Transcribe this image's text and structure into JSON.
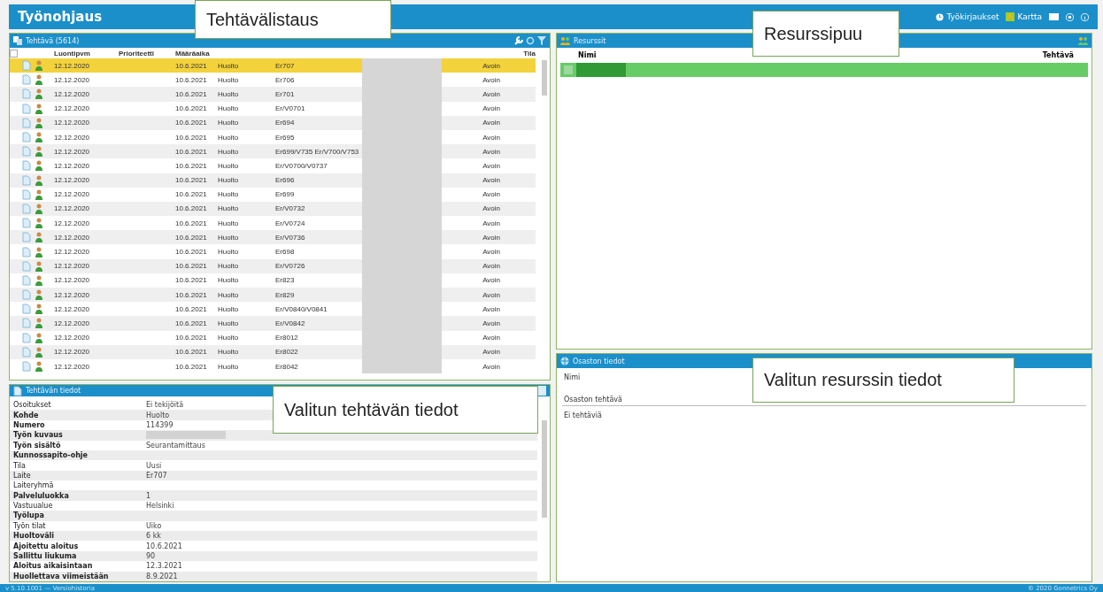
{
  "app": {
    "title": "Työnohjaus",
    "nav": [
      {
        "label": "Työkirjaukset",
        "kind": "clock"
      },
      {
        "label": "Kartta",
        "kind": "map"
      }
    ]
  },
  "task_list": {
    "title": "Tehtävä (5614)",
    "select_all_checked": false,
    "header": {
      "created": "Luontipvm",
      "priority": "Prioriteetti",
      "due": "Määräaika",
      "status": "Tila"
    },
    "rows": [
      {
        "created": "12.12.2020",
        "due": "10.6.2021",
        "type": "Huolto",
        "device": "Er707",
        "status": "Avoin",
        "selected": true
      },
      {
        "created": "12.12.2020",
        "due": "10.6.2021",
        "type": "Huolto",
        "device": "Er706",
        "status": "Avoin",
        "selected": false
      },
      {
        "created": "12.12.2020",
        "due": "10.6.2021",
        "type": "Huolto",
        "device": "Er701",
        "status": "Avoin",
        "selected": false
      },
      {
        "created": "12.12.2020",
        "due": "10.6.2021",
        "type": "Huolto",
        "device": "Er/V0701",
        "status": "Avoin",
        "selected": false
      },
      {
        "created": "12.12.2020",
        "due": "10.6.2021",
        "type": "Huolto",
        "device": "Er694",
        "status": "Avoin",
        "selected": false
      },
      {
        "created": "12.12.2020",
        "due": "10.6.2021",
        "type": "Huolto",
        "device": "Er695",
        "status": "Avoin",
        "selected": false
      },
      {
        "created": "12.12.2020",
        "due": "10.6.2021",
        "type": "Huolto",
        "device": "Er699/V735 Er/V700/V753",
        "status": "Avoin",
        "selected": false
      },
      {
        "created": "12.12.2020",
        "due": "10.6.2021",
        "type": "Huolto",
        "device": "Er/V0700/V0737",
        "status": "Avoin",
        "selected": false
      },
      {
        "created": "12.12.2020",
        "due": "10.6.2021",
        "type": "Huolto",
        "device": "Er696",
        "status": "Avoin",
        "selected": false
      },
      {
        "created": "12.12.2020",
        "due": "10.6.2021",
        "type": "Huolto",
        "device": "Er699",
        "status": "Avoin",
        "selected": false
      },
      {
        "created": "12.12.2020",
        "due": "10.6.2021",
        "type": "Huolto",
        "device": "Er/V0732",
        "status": "Avoin",
        "selected": false
      },
      {
        "created": "12.12.2020",
        "due": "10.6.2021",
        "type": "Huolto",
        "device": "Er/V0724",
        "status": "Avoin",
        "selected": false
      },
      {
        "created": "12.12.2020",
        "due": "10.6.2021",
        "type": "Huolto",
        "device": "Er/V0736",
        "status": "Avoin",
        "selected": false
      },
      {
        "created": "12.12.2020",
        "due": "10.6.2021",
        "type": "Huolto",
        "device": "Er698",
        "status": "Avoin",
        "selected": false
      },
      {
        "created": "12.12.2020",
        "due": "10.6.2021",
        "type": "Huolto",
        "device": "Er/V0726",
        "status": "Avoin",
        "selected": false
      },
      {
        "created": "12.12.2020",
        "due": "10.6.2021",
        "type": "Huolto",
        "device": "Er823",
        "status": "Avoin",
        "selected": false
      },
      {
        "created": "12.12.2020",
        "due": "10.6.2021",
        "type": "Huolto",
        "device": "Er829",
        "status": "Avoin",
        "selected": false
      },
      {
        "created": "12.12.2020",
        "due": "10.6.2021",
        "type": "Huolto",
        "device": "Er/V0840/V0841",
        "status": "Avoin",
        "selected": false
      },
      {
        "created": "12.12.2020",
        "due": "10.6.2021",
        "type": "Huolto",
        "device": "Er/V0842",
        "status": "Avoin",
        "selected": false
      },
      {
        "created": "12.12.2020",
        "due": "10.6.2021",
        "type": "Huolto",
        "device": "Er8012",
        "status": "Avoin",
        "selected": false
      },
      {
        "created": "12.12.2020",
        "due": "10.6.2021",
        "type": "Huolto",
        "device": "Er8022",
        "status": "Avoin",
        "selected": false
      },
      {
        "created": "12.12.2020",
        "due": "10.6.2021",
        "type": "Huolto",
        "device": "Er8042",
        "status": "Avoin",
        "selected": false
      }
    ]
  },
  "task_details": {
    "title": "Tehtävän tiedot",
    "fields": [
      {
        "label": "Osoitukset",
        "value": "Ei tekijöitä",
        "bold": false
      },
      {
        "label": "Kohde",
        "value": "Huolto",
        "bold": true
      },
      {
        "label": "Numero",
        "value": "114399",
        "bold": true
      },
      {
        "label": "Työn kuvaus",
        "redacted": true,
        "bold": true
      },
      {
        "label": "Työn sisältö",
        "value": "Seurantamittaus",
        "bold": true
      },
      {
        "label": "Kunnossapito-ohje",
        "bold": true
      },
      {
        "label": "Tila",
        "value": "Uusi",
        "bold": false
      },
      {
        "label": "Laite",
        "value": "Er707",
        "bold": false
      },
      {
        "label": "Laiteryhmä",
        "bold": false
      },
      {
        "label": "Palveluluokka",
        "value": "1",
        "bold": true
      },
      {
        "label": "Vastuualue",
        "value": "Helsinki",
        "bold": false
      },
      {
        "label": "Työlupa",
        "bold": true
      },
      {
        "label": "Työn tilat",
        "value": "Uiko",
        "bold": false
      },
      {
        "label": "Huoltoväli",
        "value": "6 kk",
        "bold": true
      },
      {
        "label": "Ajoitettu aloitus",
        "value": "10.6.2021",
        "bold": true
      },
      {
        "label": "Sallittu liukuma",
        "value": "90",
        "bold": true
      },
      {
        "label": "Aloitus aikaisintaan",
        "value": "12.3.2021",
        "bold": true
      },
      {
        "label": "Huollettava viimeistään",
        "value": "8.9.2021",
        "bold": true
      }
    ]
  },
  "resources": {
    "title": "Resurssit",
    "columns": [
      "Nimi",
      "Tehtävä"
    ]
  },
  "department": {
    "title": "Osaston tiedot",
    "name_label": "Nimi",
    "tasks_heading": "Osaston tehtävä",
    "tasks_empty": "Ei tehtäviä"
  },
  "footer": {
    "left": "v 5.10.1001 — Versiohistoria",
    "right": "© 2020 Gonnetrics Oy"
  },
  "annotations": [
    "Tehtävälistaus",
    "Resurssipuu",
    "Valitun tehtävän tiedot",
    "Valitun resurssin tiedot"
  ]
}
